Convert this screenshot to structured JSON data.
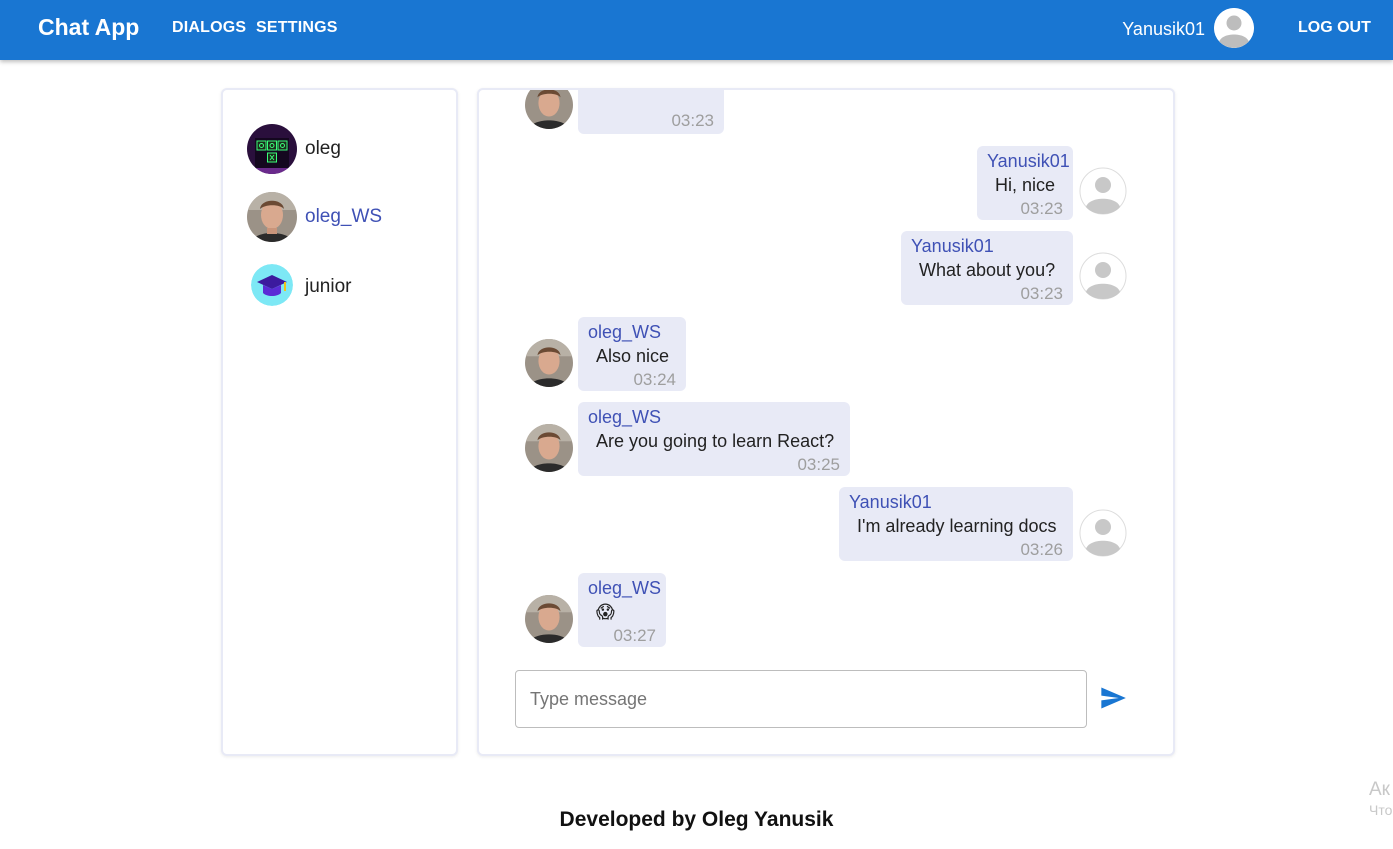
{
  "app": {
    "brand": "Chat App",
    "nav": {
      "dialogs": "DIALOGS",
      "settings": "SETTINGS"
    },
    "user": "Yanusik01",
    "logout": "LOG OUT"
  },
  "dialogs": [
    {
      "name": "oleg",
      "avatar": "game-board-avatar",
      "active": false
    },
    {
      "name": "oleg_WS",
      "avatar": "photo-avatar",
      "active": true
    },
    {
      "name": "junior",
      "avatar": "graduation-cap-avatar",
      "active": false
    }
  ],
  "messages": [
    {
      "author": "",
      "text": "",
      "time": "03:23",
      "own": false
    },
    {
      "author": "Yanusik01",
      "text": "Hi, nice",
      "time": "03:23",
      "own": true
    },
    {
      "author": "Yanusik01",
      "text": "What about you?",
      "time": "03:23",
      "own": true
    },
    {
      "author": "oleg_WS",
      "text": "Also nice",
      "time": "03:24",
      "own": false
    },
    {
      "author": "oleg_WS",
      "text": "Are you going to learn React?",
      "time": "03:25",
      "own": false
    },
    {
      "author": "Yanusik01",
      "text": "I'm already learning docs",
      "time": "03:26",
      "own": true
    },
    {
      "author": "oleg_WS",
      "text": "😱",
      "time": "03:27",
      "own": false
    }
  ],
  "composer": {
    "placeholder": "Type message",
    "value": ""
  },
  "footer": "Developed by Oleg Yanusik",
  "watermark": {
    "line1": "Ак",
    "line2": "Что"
  },
  "colors": {
    "appbar": "#1976d2",
    "bubble": "#e8eaf6",
    "author": "#3f51b5",
    "send": "#1976d2"
  }
}
